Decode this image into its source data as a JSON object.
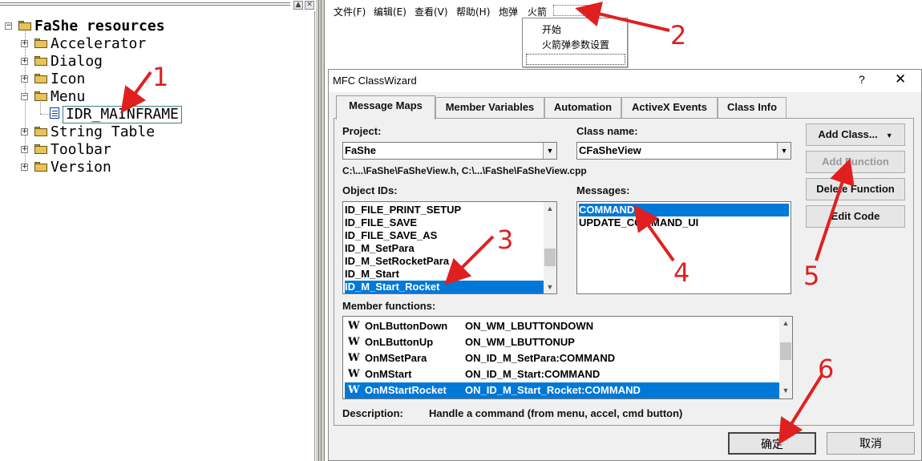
{
  "tree": {
    "root": "FaShe resources",
    "folders": [
      "Accelerator",
      "Dialog",
      "Icon",
      "Menu",
      "String Table",
      "Toolbar",
      "Version"
    ],
    "menu_child": "IDR_MAINFRAME"
  },
  "menubar": {
    "items": [
      "文件(F)",
      "编辑(E)",
      "查看(V)",
      "帮助(H)",
      "炮弹",
      "火箭"
    ]
  },
  "dropdown": {
    "items": [
      "开始",
      "火箭弹参数设置"
    ]
  },
  "dialog": {
    "title": "MFC ClassWizard",
    "help": "?",
    "close": "✕",
    "tabs": [
      "Message Maps",
      "Member Variables",
      "Automation",
      "ActiveX Events",
      "Class Info"
    ],
    "project_label": "Project:",
    "project_value": "FaShe",
    "class_label": "Class name:",
    "class_value": "CFaSheView",
    "path": "C:\\...\\FaShe\\FaSheView.h, C:\\...\\FaShe\\FaSheView.cpp",
    "object_ids_label": "Object IDs:",
    "object_ids": [
      "ID_FILE_PRINT_SETUP",
      "ID_FILE_SAVE",
      "ID_FILE_SAVE_AS",
      "ID_M_SetPara",
      "ID_M_SetRocketPara",
      "ID_M_Start",
      "ID_M_Start_Rocket"
    ],
    "messages_label": "Messages:",
    "messages": [
      "COMMAND",
      "UPDATE_COMMAND_UI"
    ],
    "buttons": {
      "add_class": "Add Class...",
      "add_function": "Add Function",
      "delete_function": "Delete Function",
      "edit_code": "Edit Code"
    },
    "member_functions_label": "Member functions:",
    "member_functions": [
      {
        "type": "W",
        "name": "OnLButtonDown",
        "map": "ON_WM_LBUTTONDOWN"
      },
      {
        "type": "W",
        "name": "OnLButtonUp",
        "map": "ON_WM_LBUTTONUP"
      },
      {
        "type": "W",
        "name": "OnMSetPara",
        "map": "ON_ID_M_SetPara:COMMAND"
      },
      {
        "type": "W",
        "name": "OnMStart",
        "map": "ON_ID_M_Start:COMMAND"
      },
      {
        "type": "W",
        "name": "OnMStartRocket",
        "map": "ON_ID_M_Start_Rocket:COMMAND"
      }
    ],
    "description_label": "Description:",
    "description": "Handle a command (from menu, accel, cmd button)",
    "ok": "确定",
    "cancel": "取消"
  },
  "annotations": [
    "1",
    "2",
    "3",
    "4",
    "5",
    "6"
  ],
  "colors": {
    "selection": "#0078d7",
    "annotation": "#e02020",
    "folder": "#e8c25a"
  }
}
